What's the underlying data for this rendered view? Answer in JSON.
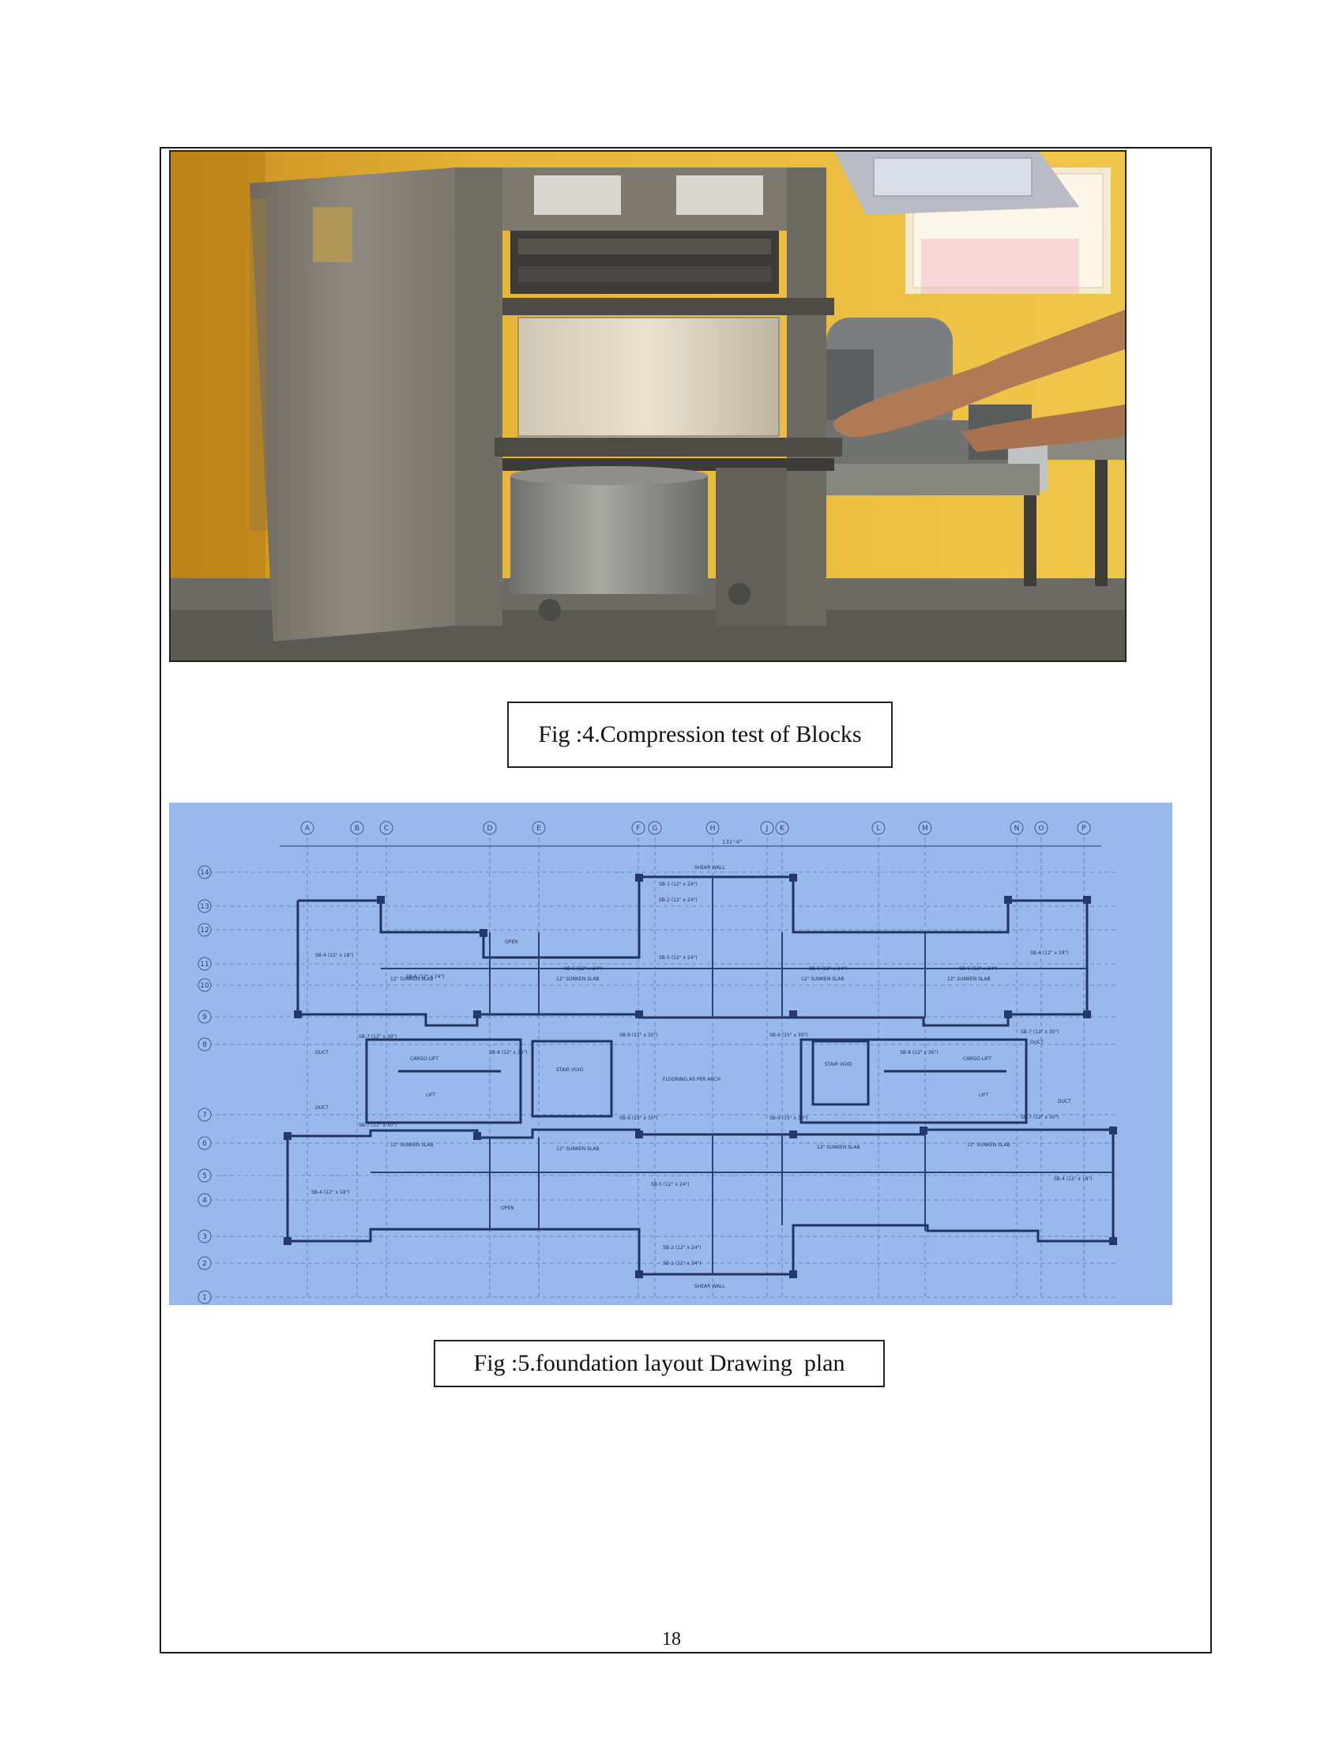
{
  "figures": [
    {
      "caption": "Fig :4.Compression test of Blocks"
    },
    {
      "caption": "Fig :5.foundation layout Drawing  plan"
    }
  ],
  "page_number": "18",
  "drawing": {
    "column_grid": [
      "A",
      "B",
      "C",
      "D",
      "E",
      "F",
      "G",
      "H",
      "J",
      "K",
      "L",
      "M",
      "N",
      "O",
      "P"
    ],
    "row_grid": [
      "14",
      "13",
      "12",
      "11",
      "10",
      "9",
      "8",
      "7",
      "6",
      "5",
      "4",
      "3",
      "2",
      "1"
    ],
    "labels": {
      "shear_wall_top": "SHEAR WALL",
      "shear_wall_bottom": "SHEAR WALL",
      "flooring": "FLOORING AS PER ARCH",
      "cargo_lift_left": "CARGO LIFT",
      "lift_left": "LIFT",
      "cargo_lift_right": "CARGO LIFT",
      "lift_right": "LIFT",
      "stair_void_left": "STAIR VOID",
      "stair_void_right": "STAIR VOID",
      "open_top": "OPEN",
      "open_bottom": "OPEN",
      "sunken_1": "12\" SUNKEN SLAB",
      "sunken_2": "12\" SUNKEN SLAB",
      "sunken_3": "12\" SUNKEN SLAB",
      "sunken_4": "12\" SUNKEN SLAB",
      "sunken_5": "12\" SUNKEN SLAB",
      "sunken_6": "12\" SUNKEN SLAB",
      "sunken_7": "12\" SUNKEN SLAB",
      "sunken_8": "12\" SUNKEN SLAB",
      "duct_left_1": "DUCT",
      "duct_left_2": "DUCT",
      "duct_right_1": "DUCT",
      "duct_right_2": "DUCT",
      "sb4_tl": "SB-4 (12\" x 18\")",
      "sb4_tr": "SB-4 (12\" x 18\")",
      "sb4_bl": "SB-4 (12\" x 18\")",
      "sb4_br": "SB-4 (12\" x 18\")",
      "sb6_1": "SB-6 (12\" x 24\")",
      "sb6_2": "SB-6 (12\" x 24\")",
      "sb6_3": "SB-6 (12\" x 24\")",
      "sb6_4": "SB-6 (12\" x 24\")",
      "sb5_top": "SB-5 (12\" x 24\")",
      "sb5_bottom": "SB-5 (12\" x 24\")",
      "sb2_top": "SB-2 (12\" x 24\")",
      "sb2_bottom": "SB-2 (12\" x 24\")",
      "sb1_top": "SB-1 (12\" x 24\")",
      "sb1_bottom": "SB-1 (12\" x 24\")",
      "sb8_left": "SB-8 (12\" x 36\")",
      "sb8_right": "SB-8 (12\" x 36\")",
      "sb9_1": "SB-9 (15\" x 30\")",
      "sb9_2": "SB-9 (15\" x 30\")",
      "sb9_3": "SB-9 (15\" x 30\")",
      "sb9_4": "SB-9 (15\" x 30\")",
      "sb7_1": "SB-7 (12\" x 30\")",
      "sb7_2": "SB-7 (12\" x 30\")",
      "sb7_3": "SB-7 (12\" x 30\")",
      "sb7_4": "SB-7 (12\" x 30\")",
      "overall_dim": "131'-4\""
    }
  }
}
